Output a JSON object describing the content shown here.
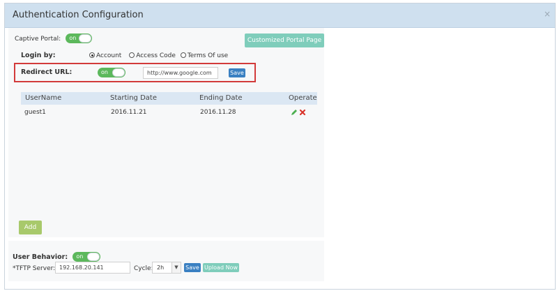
{
  "dialog": {
    "title": "Authentication Configuration",
    "close_icon": "×"
  },
  "captive": {
    "label": "Captive Portal:",
    "toggle": "on",
    "custom_button": "Customized Portal Page"
  },
  "login": {
    "label": "Login by:",
    "options": [
      "Account",
      "Access Code",
      "Terms Of use"
    ],
    "selected": "Account"
  },
  "redirect": {
    "label": "Redirect URL:",
    "toggle": "on",
    "value": "http://www.google.com",
    "save": "Save"
  },
  "table": {
    "headers": [
      "UserName",
      "Starting Date",
      "Ending Date",
      "Operate"
    ],
    "rows": [
      {
        "username": "guest1",
        "start": "2016.11.21",
        "end": "2016.11.28"
      }
    ]
  },
  "add_button": "Add",
  "behavior": {
    "label": "User Behavior:",
    "toggle": "on",
    "tftp_label": "*TFTP Server:",
    "tftp_value": "192.168.20.141",
    "cycle_label": "Cycle:",
    "cycle_value": "2h",
    "save": "Save",
    "upload": "Upload Now"
  },
  "colors": {
    "toggle_on": "#5cb85c",
    "accent_teal": "#7fcdbb",
    "accent_blue": "#3a80c2",
    "add_green": "#a8c96b",
    "highlight_red": "#d23a3a"
  }
}
